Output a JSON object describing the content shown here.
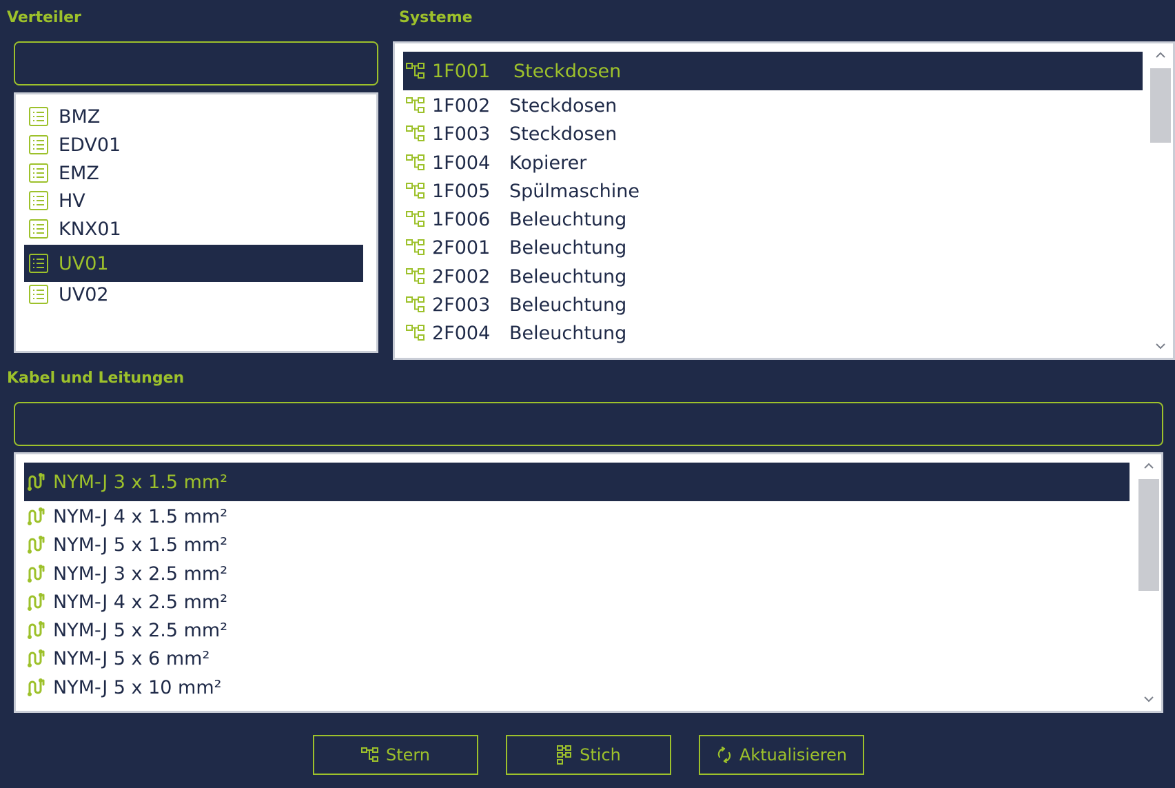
{
  "verteiler": {
    "label": "Verteiler",
    "search_value": "",
    "items": [
      {
        "label": "BMZ",
        "selected": false
      },
      {
        "label": "EDV01",
        "selected": false
      },
      {
        "label": "EMZ",
        "selected": false
      },
      {
        "label": "HV",
        "selected": false
      },
      {
        "label": "KNX01",
        "selected": false
      },
      {
        "label": "UV01",
        "selected": true
      },
      {
        "label": "UV02",
        "selected": false
      }
    ]
  },
  "systeme": {
    "label": "Systeme",
    "items": [
      {
        "code": "1F001",
        "desc": "Steckdosen",
        "selected": true
      },
      {
        "code": "1F002",
        "desc": "Steckdosen",
        "selected": false
      },
      {
        "code": "1F003",
        "desc": "Steckdosen",
        "selected": false
      },
      {
        "code": "1F004",
        "desc": "Kopierer",
        "selected": false
      },
      {
        "code": "1F005",
        "desc": "Spülmaschine",
        "selected": false
      },
      {
        "code": "1F006",
        "desc": "Beleuchtung",
        "selected": false
      },
      {
        "code": "2F001",
        "desc": "Beleuchtung",
        "selected": false
      },
      {
        "code": "2F002",
        "desc": "Beleuchtung",
        "selected": false
      },
      {
        "code": "2F003",
        "desc": "Beleuchtung",
        "selected": false
      },
      {
        "code": "2F004",
        "desc": "Beleuchtung",
        "selected": false
      }
    ]
  },
  "kabel": {
    "label": "Kabel und Leitungen",
    "search_value": "",
    "items": [
      {
        "label": "NYM-J 3 x 1.5 mm²",
        "selected": true
      },
      {
        "label": "NYM-J 4 x 1.5 mm²",
        "selected": false
      },
      {
        "label": "NYM-J 5 x 1.5 mm²",
        "selected": false
      },
      {
        "label": "NYM-J 3 x 2.5 mm²",
        "selected": false
      },
      {
        "label": "NYM-J 4 x 2.5 mm²",
        "selected": false
      },
      {
        "label": "NYM-J 5 x 2.5 mm²",
        "selected": false
      },
      {
        "label": "NYM-J 5 x 6 mm²",
        "selected": false
      },
      {
        "label": "NYM-J 5 x 10 mm²",
        "selected": false
      }
    ]
  },
  "buttons": {
    "stern": "Stern",
    "stich": "Stich",
    "aktualisieren": "Aktualisieren"
  },
  "colors": {
    "background": "#1f2a48",
    "accent": "#9dc12b",
    "panel": "#ffffff"
  },
  "icons": {
    "verteiler_item": "list-icon",
    "system_item": "tree-structure-icon",
    "kabel_item": "cable-icon",
    "stern_button": "tree-structure-icon",
    "stich_button": "grid-tree-icon",
    "aktualisieren_button": "refresh-icon"
  }
}
